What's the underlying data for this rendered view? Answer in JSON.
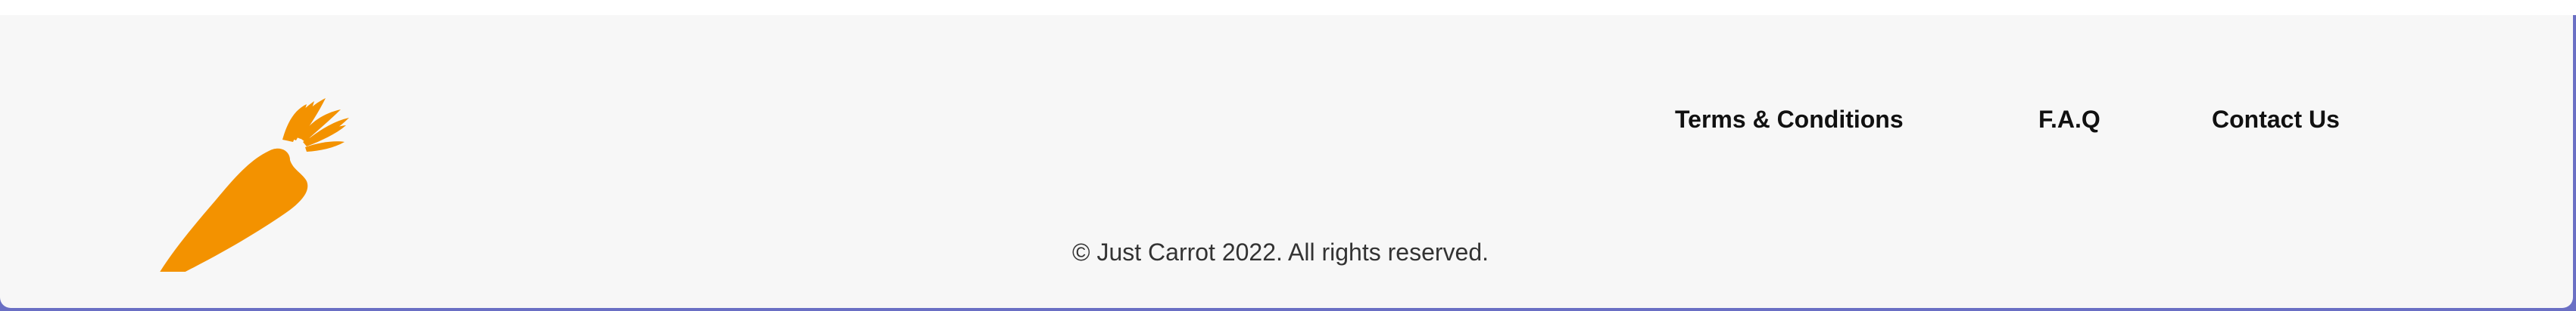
{
  "footer": {
    "logo_icon": "carrot-icon",
    "brand_color": "#f39200",
    "links": {
      "terms": "Terms & Conditions",
      "faq": "F.A.Q",
      "contact": "Contact Us"
    },
    "copyright": "© Just Carrot 2022. All rights reserved."
  }
}
